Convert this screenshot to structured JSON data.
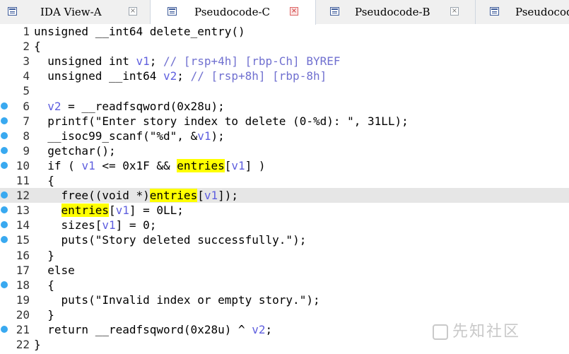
{
  "tabs": [
    {
      "label": "IDA View-A",
      "close": "×",
      "active": false
    },
    {
      "label": "Pseudocode-C",
      "close": "×",
      "active": true
    },
    {
      "label": "Pseudocode-B",
      "close": "×",
      "active": false
    },
    {
      "label": "Pseudocode",
      "close": "",
      "active": false
    }
  ],
  "colors": {
    "breakpoint_dot": "#39a9f0",
    "highlight": "#ffff00",
    "variable": "#5f5fdf",
    "current_line": "#e6e6e6"
  },
  "code": {
    "current_line": 12,
    "breakpoint_lines": [
      6,
      7,
      8,
      9,
      10,
      12,
      13,
      14,
      15,
      18,
      21
    ],
    "lines": [
      {
        "n": "1",
        "text": "unsigned __int64 delete_entry()"
      },
      {
        "n": "2",
        "text": "{"
      },
      {
        "n": "3",
        "text": "  unsigned int v1; // [rsp+4h] [rbp-Ch] BYREF"
      },
      {
        "n": "4",
        "text": "  unsigned __int64 v2; // [rsp+8h] [rbp-8h]"
      },
      {
        "n": "5",
        "text": ""
      },
      {
        "n": "6",
        "text": "  v2 = __readfsqword(0x28u);"
      },
      {
        "n": "7",
        "text": "  printf(\"Enter story index to delete (0-%d): \", 31LL);"
      },
      {
        "n": "8",
        "text": "  __isoc99_scanf(\"%d\", &v1);"
      },
      {
        "n": "9",
        "text": "  getchar();"
      },
      {
        "n": "10",
        "text": "  if ( v1 <= 0x1F && entries[v1] )"
      },
      {
        "n": "11",
        "text": "  {"
      },
      {
        "n": "12",
        "text": "    free((void *)entries[v1]);"
      },
      {
        "n": "13",
        "text": "    entries[v1] = 0LL;"
      },
      {
        "n": "14",
        "text": "    sizes[v1] = 0;"
      },
      {
        "n": "15",
        "text": "    puts(\"Story deleted successfully.\");"
      },
      {
        "n": "16",
        "text": "  }"
      },
      {
        "n": "17",
        "text": "  else"
      },
      {
        "n": "18",
        "text": "  {"
      },
      {
        "n": "19",
        "text": "    puts(\"Invalid index or empty story.\");"
      },
      {
        "n": "20",
        "text": "  }"
      },
      {
        "n": "21",
        "text": "  return __readfsqword(0x28u) ^ v2;"
      },
      {
        "n": "22",
        "text": "}"
      }
    ]
  },
  "watermark": {
    "text": "先知社区"
  }
}
